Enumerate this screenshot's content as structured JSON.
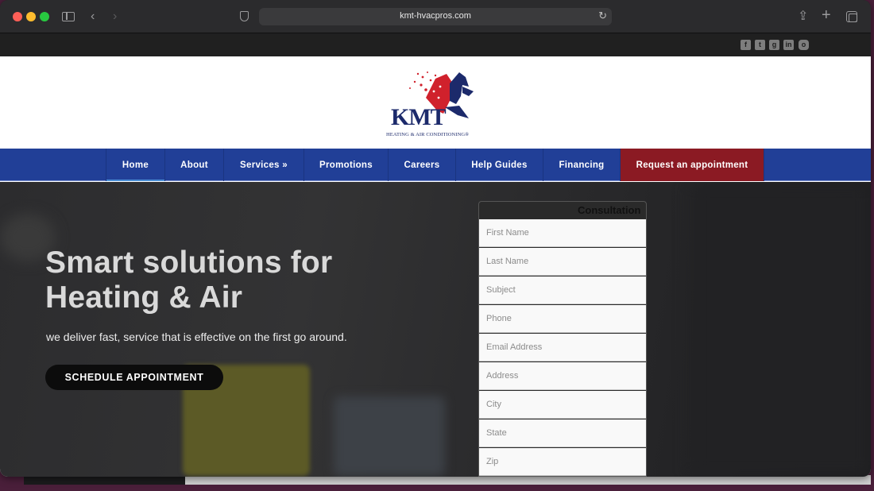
{
  "browser": {
    "url": "kmt-hvacpros.com"
  },
  "social_icons": [
    "facebook-icon",
    "twitter-icon",
    "google-plus-icon",
    "linkedin-icon",
    "instagram-icon"
  ],
  "logo": {
    "text": "KMT",
    "subtitle": "HEATING & AIR CONDITIONING®"
  },
  "nav": {
    "items": [
      {
        "label": "Home"
      },
      {
        "label": "About"
      },
      {
        "label": "Services »"
      },
      {
        "label": "Promotions"
      },
      {
        "label": "Careers"
      },
      {
        "label": "Help Guides"
      },
      {
        "label": "Financing"
      },
      {
        "label": "Request an appointment"
      }
    ]
  },
  "hero": {
    "title_line1": "Smart solutions for",
    "title_line2": "Heating & Air",
    "subtitle": "we deliver fast, service that is effective on the first go around.",
    "cta": "SCHEDULE APPOINTMENT"
  },
  "form": {
    "title": "Consultation",
    "fields": [
      "First Name",
      "Last Name",
      "Subject",
      "Phone",
      "Email Address",
      "Address",
      "City",
      "State",
      "Zip"
    ]
  },
  "colors": {
    "nav_blue": "#213f97",
    "cta_red": "#8b1a23",
    "logo_navy": "#1c2a6b",
    "logo_red": "#d0212c"
  }
}
